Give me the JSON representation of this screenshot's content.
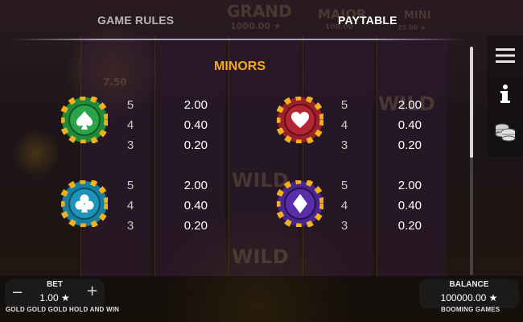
{
  "header": {
    "tabs": [
      {
        "label": "GAME RULES",
        "active": false
      },
      {
        "label": "PAYTABLE",
        "active": true
      }
    ]
  },
  "background_ghost": {
    "grand_label": "GRAND",
    "grand_value": "1000.00 ★",
    "major_label": "MAJOR",
    "major_value": "100.00",
    "mini_label": "MINI",
    "mini_value": "25.00 ★",
    "coin_value": "7.50",
    "wild": "WILD"
  },
  "section": {
    "title": "MINORS"
  },
  "paytable": [
    {
      "symbol": "green-spade-chip",
      "colors": {
        "ring": "#1f8a3b",
        "inner": "#2ba348",
        "stripe": "#f0b21c"
      },
      "rows": [
        {
          "count": "5",
          "value": "2.00"
        },
        {
          "count": "4",
          "value": "0.40"
        },
        {
          "count": "3",
          "value": "0.20"
        }
      ]
    },
    {
      "symbol": "red-heart-chip",
      "colors": {
        "ring": "#9c1f2c",
        "inner": "#b52634",
        "stripe": "#f0b21c"
      },
      "rows": [
        {
          "count": "5",
          "value": "2.00"
        },
        {
          "count": "4",
          "value": "0.40"
        },
        {
          "count": "3",
          "value": "0.20"
        }
      ]
    },
    {
      "symbol": "blue-club-chip",
      "colors": {
        "ring": "#147fa0",
        "inner": "#1c95b8",
        "stripe": "#f0b21c"
      },
      "rows": [
        {
          "count": "5",
          "value": "2.00"
        },
        {
          "count": "4",
          "value": "0.40"
        },
        {
          "count": "3",
          "value": "0.20"
        }
      ]
    },
    {
      "symbol": "purple-diamond-chip",
      "colors": {
        "ring": "#4a2490",
        "inner": "#5a2ea8",
        "stripe": "#f0b21c"
      },
      "rows": [
        {
          "count": "5",
          "value": "2.00"
        },
        {
          "count": "4",
          "value": "0.40"
        },
        {
          "count": "3",
          "value": "0.20"
        }
      ]
    }
  ],
  "side_buttons": [
    {
      "icon": "menu-icon"
    },
    {
      "icon": "info-icon"
    },
    {
      "icon": "coins-stack-icon"
    }
  ],
  "bet": {
    "label": "BET",
    "value": "1.00",
    "star": "★",
    "minus": "−",
    "plus": "+"
  },
  "balance": {
    "label": "BALANCE",
    "value": "100000.00",
    "star": "★"
  },
  "footer": {
    "game_name": "GOLD GOLD GOLD HOLD AND WIN",
    "provider": "BOOMING GAMES"
  },
  "scroll": {
    "position_fraction": 0.0,
    "visible_fraction": 0.49
  },
  "colors": {
    "accent": "#f4a81e",
    "active_tab": "#ffffff",
    "inactive_tab": "#b9b6b2"
  }
}
